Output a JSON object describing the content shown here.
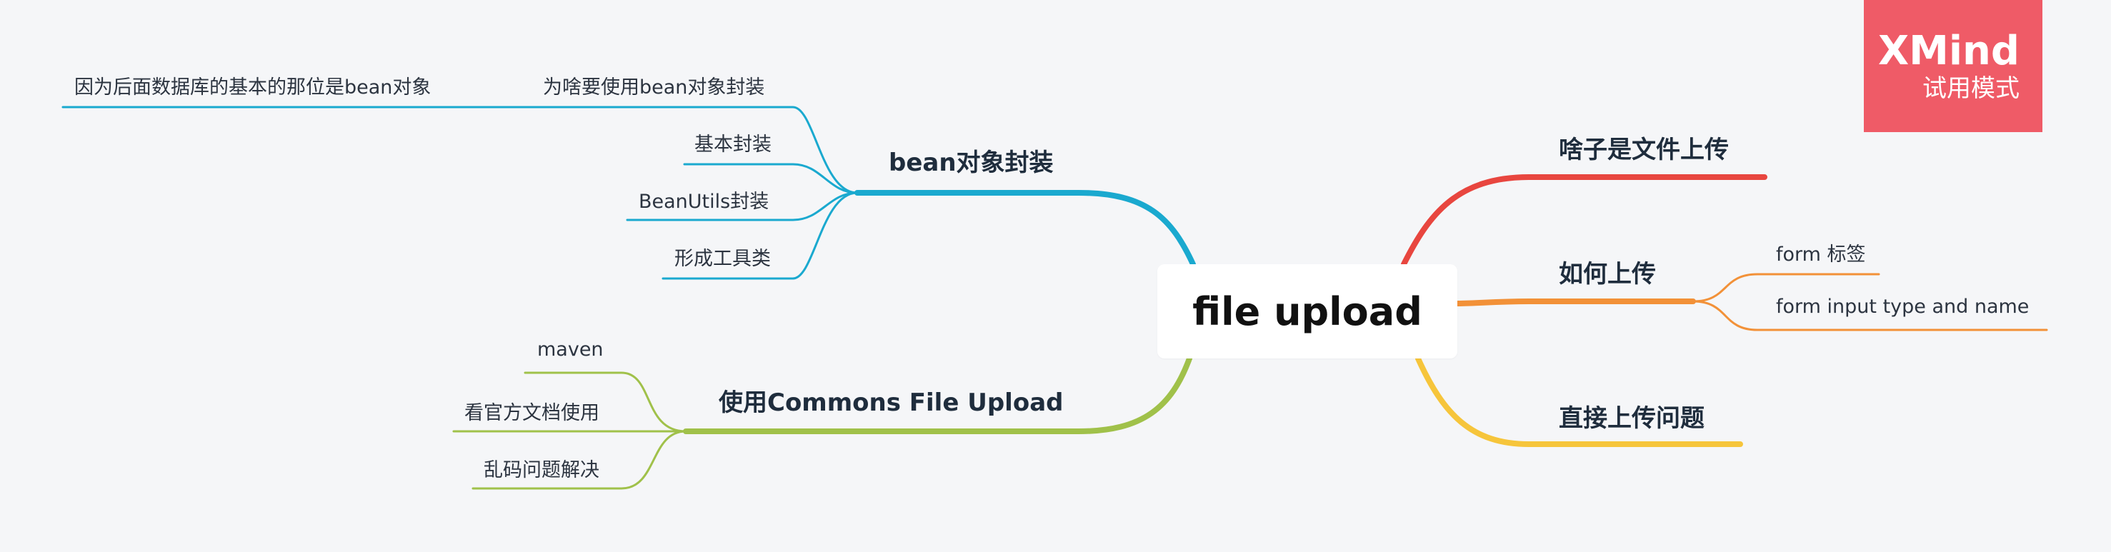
{
  "root": {
    "label": "file upload"
  },
  "watermark": {
    "brand": "XMind",
    "mode": "试用模式"
  },
  "colors": {
    "cyan": "#1aa9cf",
    "green": "#a0c14a",
    "red": "#e8463f",
    "orange": "#f29138",
    "yellow": "#f6c53b"
  },
  "branches": {
    "bean": {
      "label": "bean对象封装",
      "children": [
        {
          "label": "为啥要使用bean对象封装",
          "children": [
            {
              "label": "因为后面数据库的基本的那位是bean对象"
            }
          ]
        },
        {
          "label": "基本封装"
        },
        {
          "label": "BeanUtils封装"
        },
        {
          "label": "形成工具类"
        }
      ]
    },
    "commons": {
      "label": "使用Commons File Upload",
      "children": [
        {
          "label": "maven"
        },
        {
          "label": "看官方文档使用"
        },
        {
          "label": "乱码问题解决"
        }
      ]
    },
    "what": {
      "label": "啥子是文件上传"
    },
    "how": {
      "label": "如何上传",
      "children": [
        {
          "label": "form 标签"
        },
        {
          "label": "form input type and name"
        }
      ]
    },
    "direct": {
      "label": "直接上传问题"
    }
  }
}
